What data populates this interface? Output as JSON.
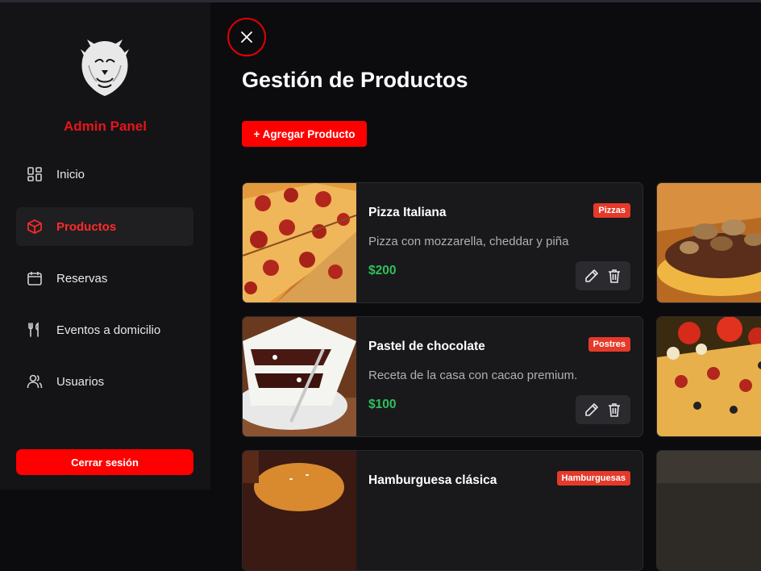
{
  "sidebar": {
    "brand": "Admin Panel",
    "items": [
      {
        "label": "Inicio",
        "icon": "dashboard-icon",
        "active": false
      },
      {
        "label": "Productos",
        "icon": "box-icon",
        "active": true
      },
      {
        "label": "Reservas",
        "icon": "calendar-icon",
        "active": false
      },
      {
        "label": "Eventos a domicilio",
        "icon": "utensils-icon",
        "active": false
      },
      {
        "label": "Usuarios",
        "icon": "users-icon",
        "active": false
      }
    ],
    "logout_label": "Cerrar sesión"
  },
  "main": {
    "title": "Gestión de Productos",
    "add_label": "+ Agregar Producto",
    "products": [
      {
        "name": "Pizza Italiana",
        "category": "Pizzas",
        "description": "Pizza con mozzarella, cheddar y piña",
        "price": "$200"
      },
      {
        "name": "Pastel de chocolate",
        "category": "Postres",
        "description": "Receta de la casa con cacao premium.",
        "price": "$100"
      },
      {
        "name": "Hamburguesa clásica",
        "category": "Hamburguesas",
        "description": "",
        "price": ""
      }
    ]
  },
  "colors": {
    "accent": "#ff0000",
    "price": "#2ec05a",
    "badge": "#e53a2a",
    "brand": "#e8141c"
  }
}
